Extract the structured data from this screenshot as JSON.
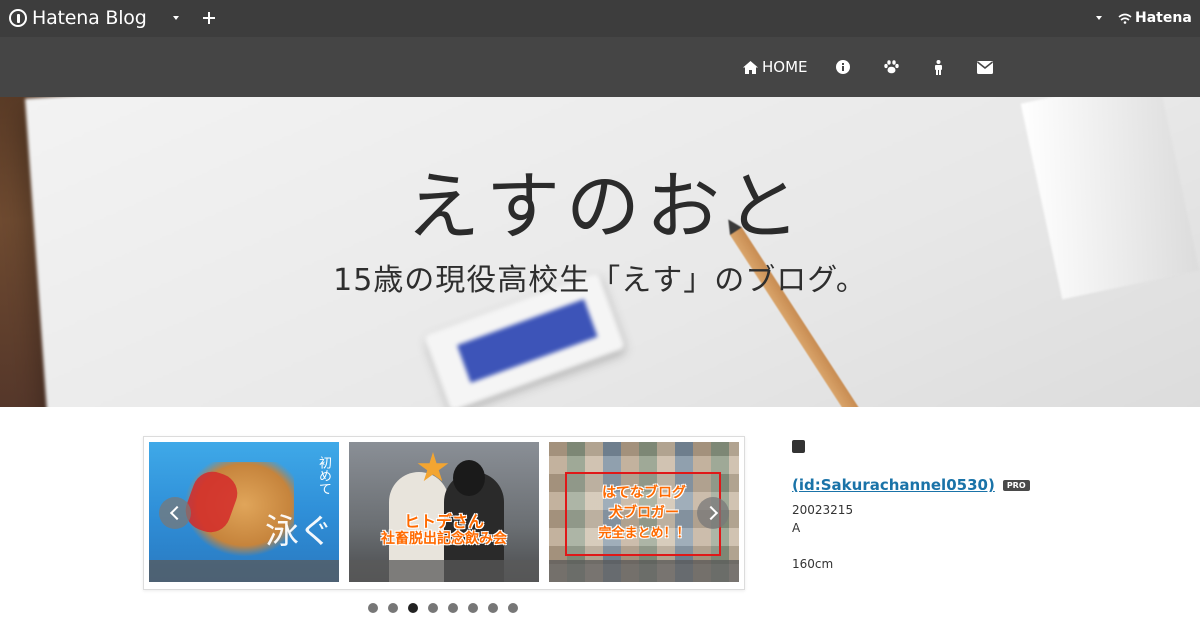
{
  "topbar": {
    "logo_text": "Hatena Blog",
    "brand_text": "Hatena",
    "colors": {
      "bar": "#3d3d3d"
    }
  },
  "nav": {
    "home_label": "HOME",
    "icons": [
      "home-icon",
      "info-icon",
      "paw-icon",
      "person-icon",
      "envelope-icon"
    ]
  },
  "banner": {
    "title": "えすのおと",
    "subtitle": "15歳の現役高校生「えす」のブログ。"
  },
  "carousel": {
    "slides": [
      {
        "text_a": "初めて",
        "text_b": "泳ぐ"
      },
      {
        "text_a": "ヒトデさん",
        "text_b": "社畜脱出記念飲み会"
      },
      {
        "text_a": "はてなブログ",
        "text_b": "犬ブロガー",
        "text_c": "完全まとめ！！"
      }
    ],
    "dot_count": 8,
    "active_dot": 3
  },
  "profile": {
    "id_label": " (id:Sakurachannel0530)",
    "badge": "PRO",
    "line1": "20023215",
    "line2": "A",
    "line3": "160cm",
    "colors": {
      "link": "#1a73a8"
    }
  }
}
